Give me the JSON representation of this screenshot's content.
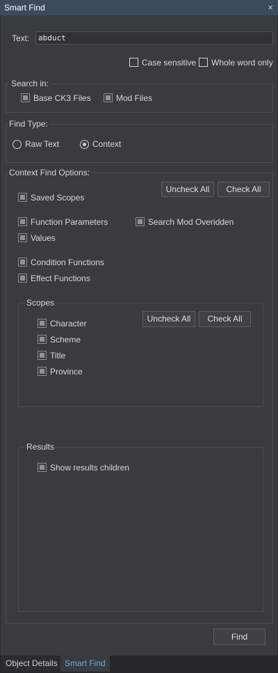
{
  "window": {
    "title": "Smart Find",
    "close_glyph": "×"
  },
  "text_field": {
    "label": "Text:",
    "value": "abduct"
  },
  "options": {
    "case_sensitive": "Case sensitive",
    "whole_word": "Whole word only"
  },
  "search_in": {
    "title": "Search in:",
    "base_files": "Base CK3 Files",
    "mod_files": "Mod Files"
  },
  "find_type": {
    "title": "Find Type:",
    "raw_text": "Raw Text",
    "context": "Context",
    "selected": "context"
  },
  "context_options": {
    "title": "Context Find Options:",
    "uncheck_all": "Uncheck All",
    "check_all": "Check All",
    "saved_scopes": "Saved Scopes",
    "function_parameters": "Function Parameters",
    "search_mod_overidden": "Search Mod Overidden",
    "values": "Values",
    "condition_functions": "Condition Functions",
    "effect_functions": "Effect Functions"
  },
  "scopes": {
    "title": "Scopes",
    "uncheck_all": "Uncheck All",
    "check_all": "Check All",
    "items": [
      "Character",
      "Scheme",
      "Title",
      "Province"
    ]
  },
  "results": {
    "title": "Results",
    "show_children": "Show results children"
  },
  "find_button": "Find",
  "tabs": [
    {
      "label": "Object Details",
      "active": false
    },
    {
      "label": "Smart Find",
      "active": true
    }
  ],
  "colors": {
    "title_bar": "#3c4a5e",
    "panel_bg": "#383b3f",
    "active_tab_text": "#6fa8dc"
  }
}
